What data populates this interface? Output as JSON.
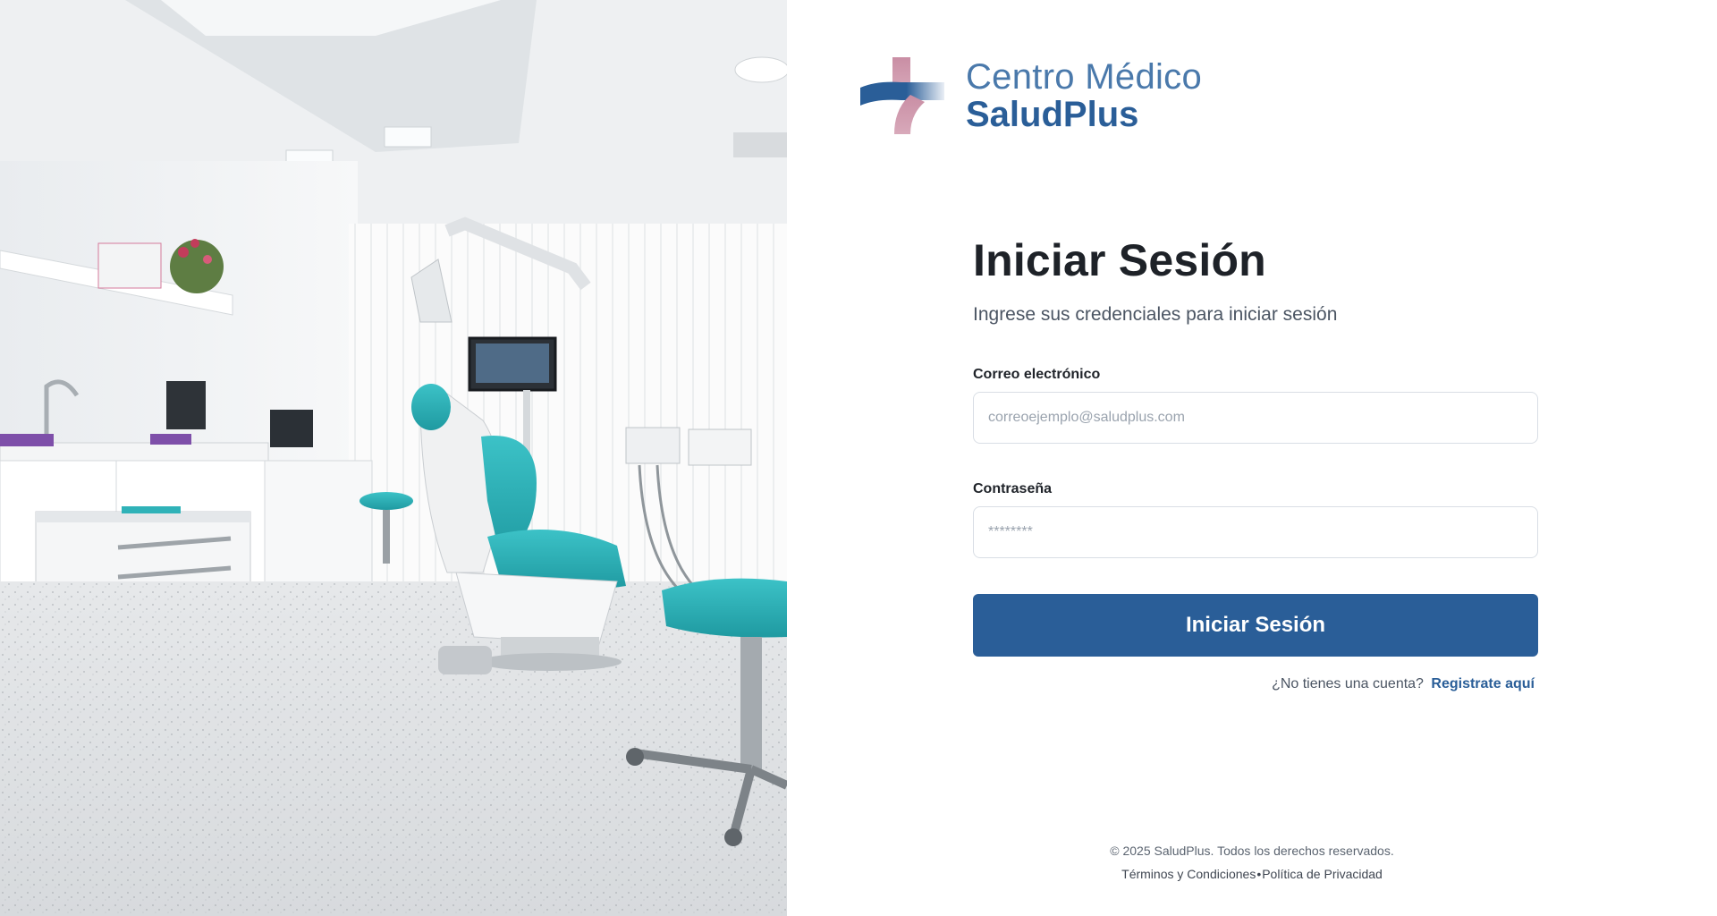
{
  "brand": {
    "line1": "Centro Médico",
    "line2": "SaludPlus",
    "logo_icon": "medical-cross-logo",
    "colors": {
      "blue": "#2a5e98",
      "light_blue": "#4a79ab",
      "pink": "#c98ea4"
    }
  },
  "photo": {
    "icon": "dental-clinic-photo"
  },
  "form": {
    "title": "Iniciar Sesión",
    "subtitle": "Ingrese sus credenciales para iniciar sesión",
    "email": {
      "label": "Correo electrónico",
      "placeholder": "correoejemplo@saludplus.com",
      "value": ""
    },
    "password": {
      "label": "Contraseña",
      "placeholder": "********",
      "value": ""
    },
    "submit_label": "Iniciar Sesión",
    "register_prompt": "¿No tienes una cuenta?",
    "register_link": "Registrate aquí"
  },
  "footer": {
    "copyright": "© 2025 SaludPlus. Todos los derechos reservados.",
    "terms": "Términos y Condiciones",
    "separator": "•",
    "privacy": "Política de Privacidad"
  },
  "colors": {
    "primary": "#2a5e98",
    "input_border": "#d9dee5",
    "teal": "#2fb2b8"
  }
}
